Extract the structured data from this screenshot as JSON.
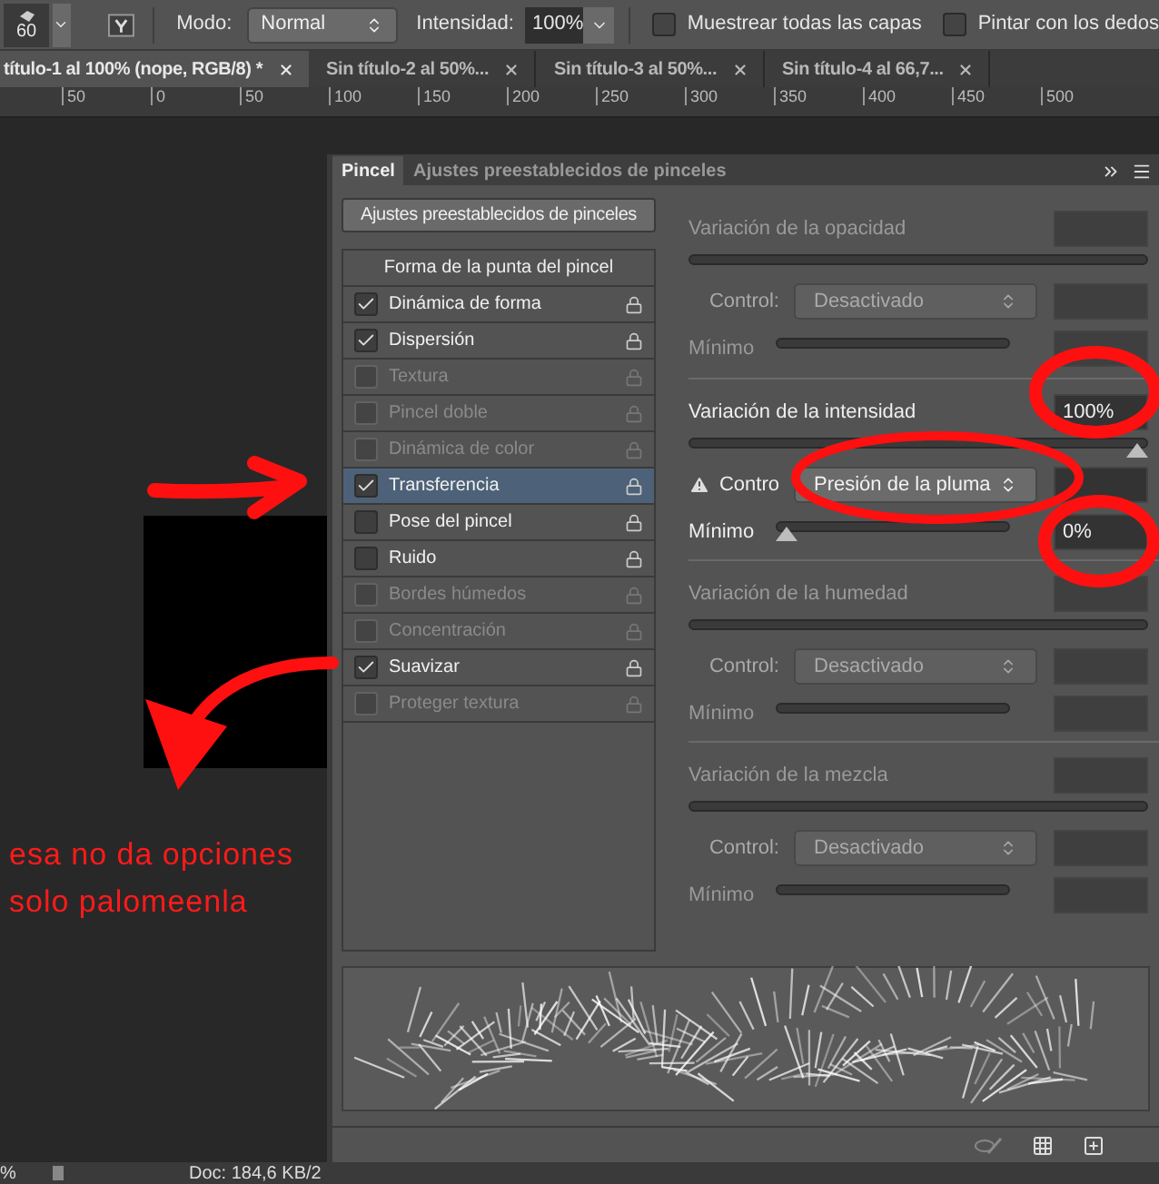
{
  "toolbar": {
    "brush_size": "60",
    "mode_label": "Modo:",
    "mode_value": "Normal",
    "intensity_label": "Intensidad:",
    "intensity_value": "100%",
    "checkboxes": [
      {
        "label": "Muestrear todas las capas",
        "checked": false
      },
      {
        "label": "Pintar con los dedos",
        "checked": false
      }
    ]
  },
  "document_tabs": [
    {
      "label": "título-1 al 100% (nope, RGB/8) *",
      "selected": true
    },
    {
      "label": "Sin título-2 al 50%...",
      "selected": false
    },
    {
      "label": "Sin título-3 al 50%...",
      "selected": false
    },
    {
      "label": "Sin título-4 al 66,7...",
      "selected": false
    }
  ],
  "ruler": {
    "labels": [
      "50",
      "0",
      "50",
      "100",
      "150",
      "200",
      "250",
      "300",
      "350",
      "400",
      "450",
      "500"
    ]
  },
  "annotation": {
    "lines": [
      "esa no da opciones",
      "solo palomeenla"
    ]
  },
  "panel": {
    "tabs": [
      {
        "label": "Pincel",
        "selected": true
      },
      {
        "label": "Ajustes preestablecidos de pinceles",
        "selected": false
      }
    ],
    "presets_button": "Ajustes preestablecidos de pinceles",
    "tip_shape": "Forma de la punta del pincel",
    "options": [
      {
        "label": "Dinámica de forma",
        "checked": true,
        "disabled": false,
        "selected": false
      },
      {
        "label": "Dispersión",
        "checked": true,
        "disabled": false,
        "selected": false
      },
      {
        "label": "Textura",
        "checked": false,
        "disabled": true,
        "selected": false
      },
      {
        "label": "Pincel doble",
        "checked": false,
        "disabled": true,
        "selected": false
      },
      {
        "label": "Dinámica de color",
        "checked": false,
        "disabled": true,
        "selected": false
      },
      {
        "label": "Transferencia",
        "checked": true,
        "disabled": false,
        "selected": true
      },
      {
        "label": "Pose del pincel",
        "checked": false,
        "disabled": false,
        "selected": false
      },
      {
        "label": "Ruido",
        "checked": false,
        "disabled": false,
        "selected": false
      },
      {
        "label": "Bordes húmedos",
        "checked": false,
        "disabled": true,
        "selected": false
      },
      {
        "label": "Concentración",
        "checked": false,
        "disabled": true,
        "selected": false
      },
      {
        "label": "Suavizar",
        "checked": true,
        "disabled": false,
        "selected": false
      },
      {
        "label": "Proteger textura",
        "checked": false,
        "disabled": true,
        "selected": false
      }
    ],
    "sections": [
      {
        "title": "Variación de la opacidad",
        "disabled": true,
        "control_label": "Control:",
        "control_value": "Desactivado",
        "warning": false,
        "minimum_label": "Mínimo"
      },
      {
        "title": "Variación de la intensidad",
        "disabled": false,
        "value": "100%",
        "level": 1,
        "control_label": "Contro",
        "control_value": "Presión de la pluma",
        "warning": true,
        "minimum_label": "Mínimo",
        "minimum": {
          "value": "0%",
          "level": 0
        }
      },
      {
        "title": "Variación de la humedad",
        "disabled": true,
        "control_label": "Control:",
        "control_value": "Desactivado",
        "warning": false,
        "minimum_label": "Mínimo"
      },
      {
        "title": "Variación de la mezcla",
        "disabled": true,
        "control_label": "Control:",
        "control_value": "Desactivado",
        "warning": false,
        "minimum_label": "Mínimo"
      }
    ]
  },
  "status_bar": {
    "zoom": "%",
    "doc": "Doc: 184,6 KB/2"
  }
}
